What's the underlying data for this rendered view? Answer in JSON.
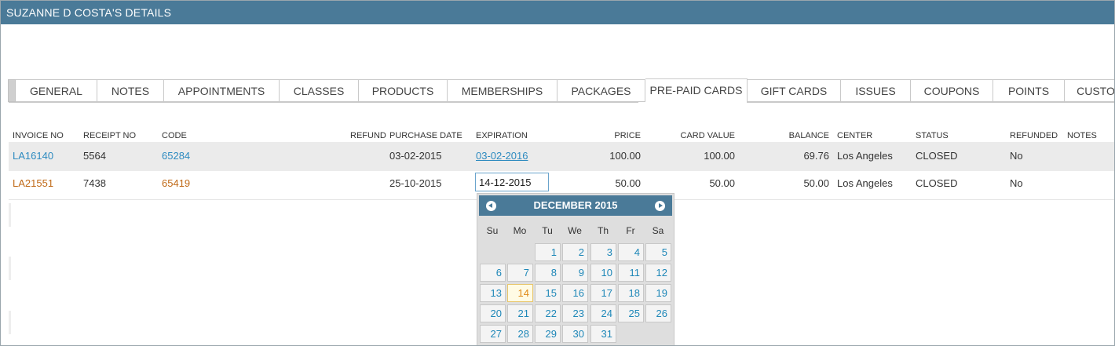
{
  "window": {
    "title": "SUZANNE D COSTA'S DETAILS"
  },
  "tabs": [
    "GENERAL",
    "NOTES",
    "APPOINTMENTS",
    "CLASSES",
    "PRODUCTS",
    "MEMBERSHIPS",
    "PACKAGES",
    "PRE-PAID CARDS",
    "GIFT CARDS",
    "ISSUES",
    "COUPONS",
    "POINTS",
    "CUSTO"
  ],
  "active_tab": "PRE-PAID CARDS",
  "table": {
    "headers": {
      "invoice_no": "INVOICE NO",
      "receipt_no": "RECEIPT NO",
      "code": "CODE",
      "refund": "REFUND",
      "purchase_date": "PURCHASE DATE",
      "expiration": "EXPIRATION",
      "price": "PRICE",
      "card_value": "CARD VALUE",
      "balance": "BALANCE",
      "center": "CENTER",
      "status": "STATUS",
      "refunded": "REFUNDED",
      "notes": "NOTES"
    },
    "rows": [
      {
        "invoice_no": "LA16140",
        "receipt_no": "5564",
        "code": "65284",
        "purchase_date": "03-02-2015",
        "expiration": "03-02-2016",
        "price": "100.00",
        "card_value": "100.00",
        "balance": "69.76",
        "center": "Los Angeles",
        "status": "CLOSED",
        "refunded": "No"
      },
      {
        "invoice_no": "LA21551",
        "receipt_no": "7438",
        "code": "65419",
        "purchase_date": "25-10-2015",
        "expiration": "14-12-2015",
        "price": "50.00",
        "card_value": "50.00",
        "balance": "50.00",
        "center": "Los Angeles",
        "status": "CLOSED",
        "refunded": "No"
      }
    ]
  },
  "datepicker": {
    "month_label": "DECEMBER 2015",
    "weekdays": [
      "Su",
      "Mo",
      "Tu",
      "We",
      "Th",
      "Fr",
      "Sa"
    ],
    "days": [
      "1",
      "2",
      "3",
      "4",
      "5",
      "6",
      "7",
      "8",
      "9",
      "10",
      "11",
      "12",
      "13",
      "14",
      "15",
      "16",
      "17",
      "18",
      "19",
      "20",
      "21",
      "22",
      "23",
      "24",
      "25",
      "26",
      "27",
      "28",
      "29",
      "30",
      "31"
    ],
    "selected_day": "14",
    "colors": {
      "header": "#4a7a98",
      "day_text": "#1e87b8",
      "today_text": "#e08a16"
    }
  },
  "colors": {
    "titlebar": "#4a7a98",
    "link_blue": "#2e8bc0",
    "link_orange": "#c06a18",
    "row_highlight": "#ebebeb"
  }
}
